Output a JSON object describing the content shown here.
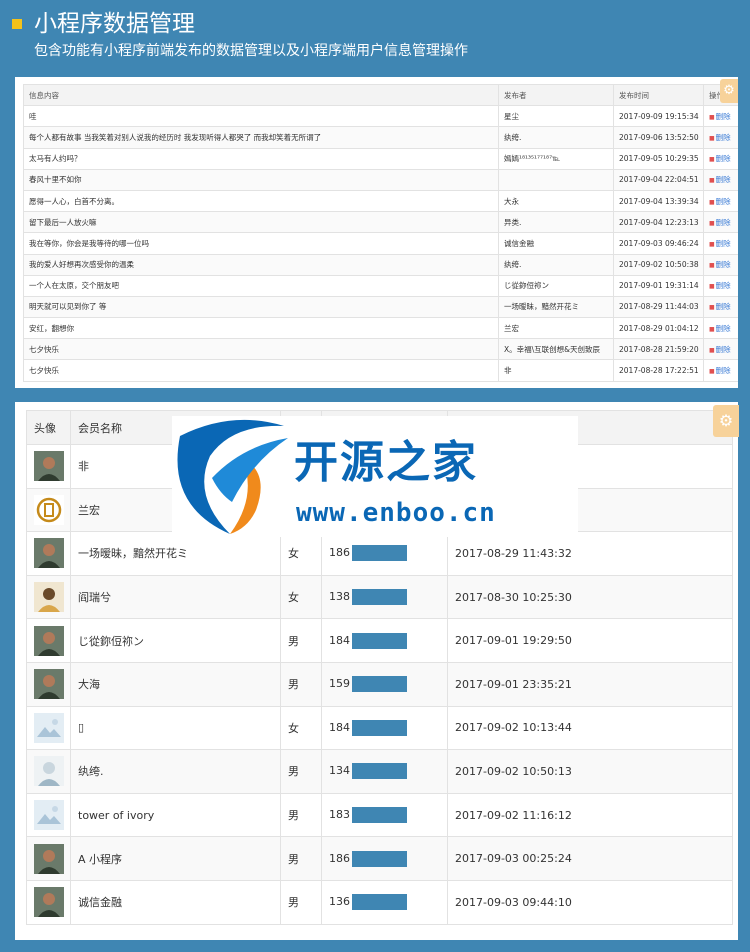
{
  "header": {
    "title": "小程序数据管理",
    "subtitle": "包含功能有小程序前端发布的数据管理以及小程序端用户信息管理操作"
  },
  "posts_table": {
    "columns": [
      "信息内容",
      "发布者",
      "发布时间",
      "操作"
    ],
    "delete_label": "删除",
    "rows": [
      {
        "content": "哇",
        "author": "星尘",
        "time": "2017-09-09 19:15:34"
      },
      {
        "content": "每个人都有故事 当我笑着对别人说我的经历时 我发现听得人都哭了 而我却笑着无所谓了",
        "author": "纨绔.",
        "time": "2017-09-06 13:52:50"
      },
      {
        "content": "太马有人约吗？",
        "author": "嫣嫣¹⁸¹³⁵¹⁷⁷¹⁸⁷℡",
        "time": "2017-09-05 10:29:35"
      },
      {
        "content": "春风十里不如你",
        "author": "",
        "time": "2017-09-04 22:04:51"
      },
      {
        "content": "愿得一人心，白首不分离。",
        "author": "大永",
        "time": "2017-09-04 13:39:34"
      },
      {
        "content": "留下最后一人放火嘛",
        "author": "异类.",
        "time": "2017-09-04 12:23:13"
      },
      {
        "content": "我在等你，你会是我等待的哪一位吗",
        "author": "诚信金融",
        "time": "2017-09-03 09:46:24"
      },
      {
        "content": "我的爱人好想再次感受你的温柔",
        "author": "纨绔.",
        "time": "2017-09-02 10:50:38"
      },
      {
        "content": "一个人在太原，交个朋友吧",
        "author": "じ從鉨侸祢ン",
        "time": "2017-09-01 19:31:14"
      },
      {
        "content": "明天就可以见到你了 等",
        "author": "一场暧昧，黯然开花ミ",
        "time": "2017-08-29 11:44:03"
      },
      {
        "content": "安红，翻想你",
        "author": "兰宏",
        "time": "2017-08-29 01:04:12"
      },
      {
        "content": "七夕快乐",
        "author": "X。幸福\\互联创想&天创致辰",
        "time": "2017-08-28 21:59:20"
      },
      {
        "content": "七夕快乐",
        "author": "非",
        "time": "2017-08-28 17:22:51"
      }
    ]
  },
  "members_table": {
    "columns": [
      "头像",
      "会员名称",
      "",
      "",
      ""
    ],
    "rows": [
      {
        "avatar": "photo-avatar-icon",
        "name": "非",
        "gender": "",
        "phone": "",
        "time": ""
      },
      {
        "avatar": "logo-avatar-icon",
        "name": "兰宏",
        "gender": "",
        "phone": "",
        "time": ""
      },
      {
        "avatar": "photo-avatar-icon",
        "name": "一场暧昧，黯然开花ミ",
        "gender": "女",
        "phone": "186",
        "time": "2017-08-29 11:43:32"
      },
      {
        "avatar": "cartoon-avatar-icon",
        "name": "阎瑞兮",
        "gender": "女",
        "phone": "138",
        "time": "2017-08-30 10:25:30"
      },
      {
        "avatar": "photo-avatar-icon",
        "name": "じ從鉨侸祢ン",
        "gender": "男",
        "phone": "184",
        "time": "2017-09-01 19:29:50"
      },
      {
        "avatar": "photo-avatar-icon",
        "name": "大海",
        "gender": "男",
        "phone": "159",
        "time": "2017-09-01 23:35:21"
      },
      {
        "avatar": "placeholder-avatar-icon",
        "name": "▯",
        "gender": "女",
        "phone": "184",
        "time": "2017-09-02 10:13:44"
      },
      {
        "avatar": "sketch-avatar-icon",
        "name": "纨绔.",
        "gender": "男",
        "phone": "134",
        "time": "2017-09-02 10:50:13"
      },
      {
        "avatar": "placeholder-avatar-icon",
        "name": "tower of ivory",
        "gender": "男",
        "phone": "183",
        "time": "2017-09-02 11:16:12"
      },
      {
        "avatar": "photo-avatar-icon",
        "name": "A 小程序",
        "gender": "男",
        "phone": "186",
        "time": "2017-09-03 00:25:24"
      },
      {
        "avatar": "photo-avatar-icon",
        "name": "诚信金融",
        "gender": "男",
        "phone": "136",
        "time": "2017-09-03 09:44:10"
      }
    ]
  },
  "watermark": {
    "brand": "开源之家",
    "url": "www.enboo.cn"
  },
  "colors": {
    "background": "#3f86b3",
    "accent": "#f3c21b",
    "watermark": "#0a67b5"
  }
}
